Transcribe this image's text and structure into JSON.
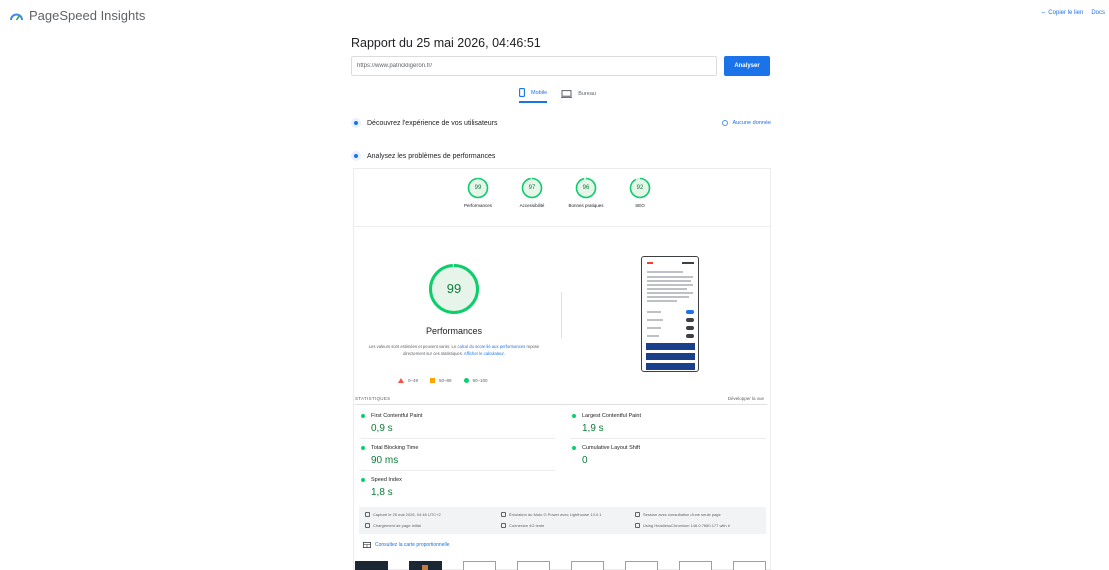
{
  "app": {
    "name": "PageSpeed Insights"
  },
  "header": {
    "copy_link": "⇔ Copier le lien",
    "docs": "Docs"
  },
  "report": {
    "title": "Rapport du 25 mai 2026, 04:46:51",
    "url_value": "https://www.patrickligeron.fr/",
    "analyze_label": "Analyser"
  },
  "tabs": [
    {
      "label": "Mobile",
      "active": true
    },
    {
      "label": "Bureau",
      "active": false
    }
  ],
  "sections": {
    "experience": "Découvrez l'expérience de vos utilisateurs",
    "no_data": "Aucune donnée",
    "diagnose": "Analysez les problèmes de performances"
  },
  "scores": [
    {
      "value": 99,
      "label": "Performances"
    },
    {
      "value": 97,
      "label": "Accessibilité"
    },
    {
      "value": 96,
      "label": "Bonnes pratiques"
    },
    {
      "value": 92,
      "label": "SEO"
    }
  ],
  "performance": {
    "score": 99,
    "title": "Performances",
    "desc_prefix": "Les valeurs sont estimées et peuvent varier. Le ",
    "desc_link": "calcul du score lié aux performances",
    "desc_middle": " repose directement sur ces statistiques. ",
    "desc_link2": "Afficher le calculateur."
  },
  "legend": [
    {
      "range": "0–49",
      "shape": "triangle",
      "color": "#ff4e42"
    },
    {
      "range": "50–89",
      "shape": "square",
      "color": "#ffa400"
    },
    {
      "range": "90–100",
      "shape": "circle",
      "color": "#0cce6b"
    }
  ],
  "stats": {
    "heading": "STATISTIQUES",
    "expand": "Développer la vue",
    "metrics": [
      {
        "label": "First Contentful Paint",
        "value": "0,9 s"
      },
      {
        "label": "Largest Contentful Paint",
        "value": "1,9 s"
      },
      {
        "label": "Total Blocking Time",
        "value": "90 ms"
      },
      {
        "label": "Cumulative Layout Shift",
        "value": "0"
      },
      {
        "label": "Speed Index",
        "value": "1,8 s"
      }
    ]
  },
  "footer_info": [
    "Capturé le 25 mai 2026, 04:46 UTC+2",
    "Émulation du Moto G Power avec Lighthouse 13.0.1",
    "Session avec consultation d'une seule page",
    "Chargement de page initial",
    "Connexion 4G lente",
    "Using HeadlessChromium 146.0.7680.177 with lr"
  ],
  "treemap": {
    "label": "Consultez la carte proportionnelle"
  },
  "colors": {
    "accent": "#1a73e8",
    "pass": "#0cce6b",
    "pass_text": "#0c7d37"
  }
}
